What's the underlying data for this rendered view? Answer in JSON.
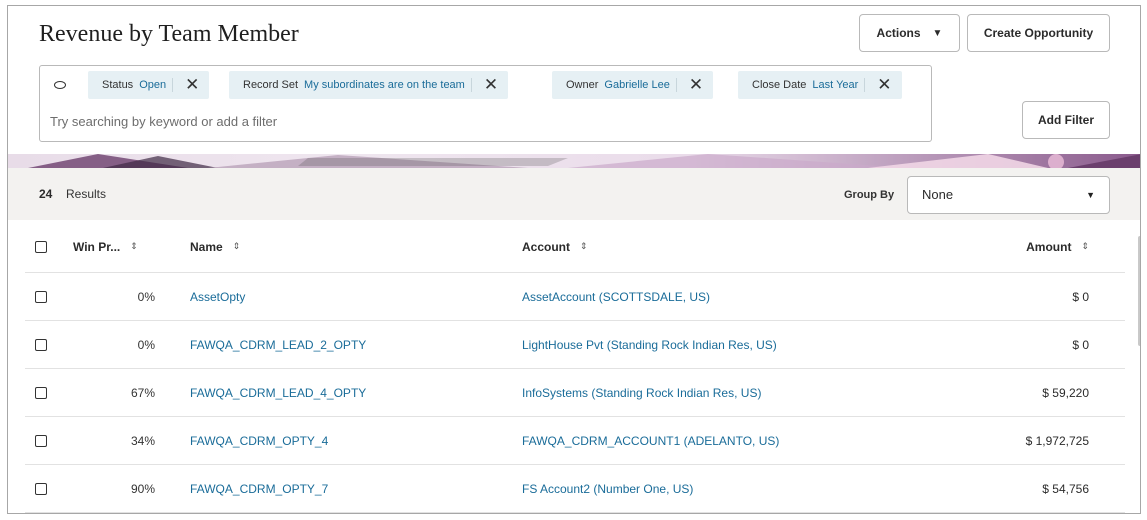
{
  "page": {
    "title": "Revenue by Team Member"
  },
  "toolbar": {
    "actions_label": "Actions",
    "create_label": "Create Opportunity",
    "add_filter_label": "Add Filter"
  },
  "filters": {
    "chips": [
      {
        "key": "Status",
        "value": "Open"
      },
      {
        "key": "Record Set",
        "value": "My subordinates are on the team"
      },
      {
        "key": "Owner",
        "value": "Gabrielle Lee"
      },
      {
        "key": "Close Date",
        "value": "Last Year"
      }
    ],
    "search_placeholder": "Try searching by keyword or add a filter"
  },
  "results": {
    "count": "24",
    "label": "Results",
    "group_by_label": "Group By",
    "group_by_value": "None"
  },
  "table": {
    "columns": [
      "Win Pr...",
      "Name",
      "Account",
      "Amount"
    ],
    "rows": [
      {
        "win": "0%",
        "name": "AssetOpty",
        "account": "AssetAccount (SCOTTSDALE, US)",
        "amount": "$ 0"
      },
      {
        "win": "0%",
        "name": "FAWQA_CDRM_LEAD_2_OPTY",
        "account": "LightHouse Pvt (Standing Rock Indian Res, US)",
        "amount": "$ 0"
      },
      {
        "win": "67%",
        "name": "FAWQA_CDRM_LEAD_4_OPTY",
        "account": "InfoSystems (Standing Rock Indian Res, US)",
        "amount": "$ 59,220"
      },
      {
        "win": "34%",
        "name": "FAWQA_CDRM_OPTY_4",
        "account": "FAWQA_CDRM_ACCOUNT1 (ADELANTO, US)",
        "amount": "$ 1,972,725"
      },
      {
        "win": "90%",
        "name": "FAWQA_CDRM_OPTY_7",
        "account": "FS Account2 (Number One, US)",
        "amount": "$ 54,756"
      }
    ]
  },
  "icons": {
    "filter": "filter-icon",
    "chip_remove": "close-icon",
    "dropdown": "chevron-down-icon",
    "sort": "sort-icon"
  },
  "colors": {
    "link": "#1a6c99",
    "chip_bg": "#e6f0f4",
    "results_bar_bg": "#f3f2f0"
  }
}
